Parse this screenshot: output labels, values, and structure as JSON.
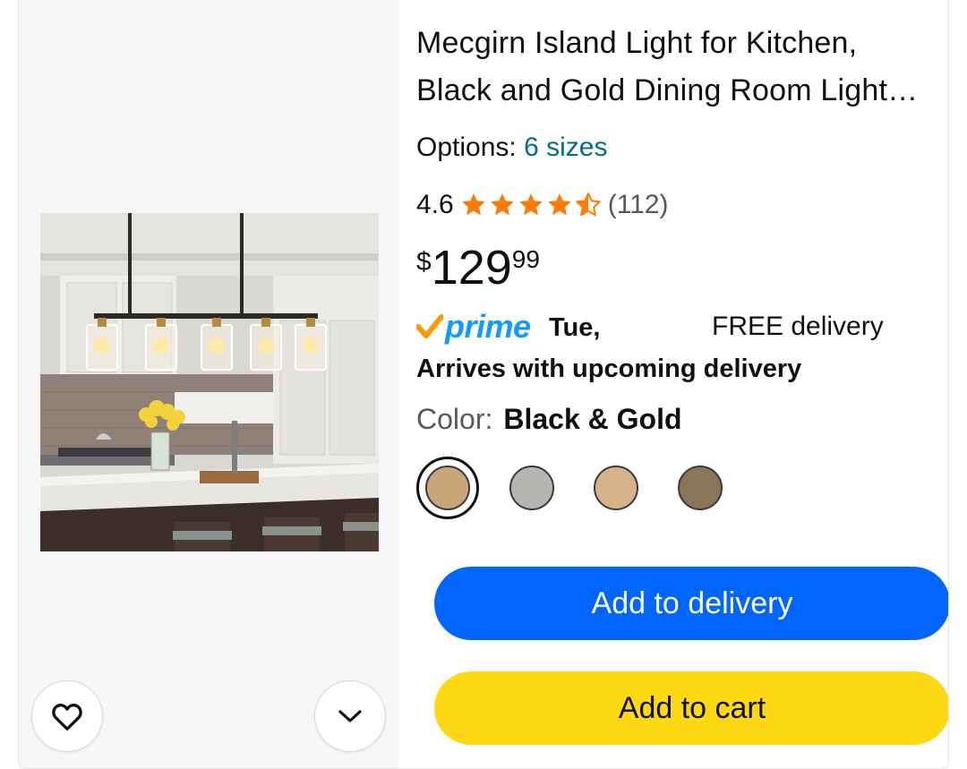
{
  "product": {
    "title": "Mecgirn Island Light for Kitchen, Black and Gold Dining Room Light Fixture",
    "options_label": "Options:",
    "options_value": "6 sizes",
    "rating_value": "4.6",
    "rating_count": "(112)",
    "rating_stars": 4.6,
    "price_symbol": "$",
    "price_whole": "129",
    "price_fraction": "99",
    "prime_label": "prime",
    "delivery_day": "Tue,",
    "delivery_text": "FREE delivery",
    "arrives_text": "Arrives with upcoming delivery",
    "color_label": "Color:",
    "color_value": "Black & Gold",
    "swatches": [
      {
        "color": "#c9a57a",
        "selected": true
      },
      {
        "color": "#b6b6b1",
        "selected": false
      },
      {
        "color": "#d4b38c",
        "selected": false
      },
      {
        "color": "#8a7559",
        "selected": false
      }
    ]
  },
  "buttons": {
    "add_to_delivery": "Add to delivery",
    "add_to_cart": "Add to cart"
  },
  "icons": {
    "wishlist": "heart-icon",
    "more": "chevron-down-icon"
  },
  "colors": {
    "link": "#007185",
    "star": "#ff7a00",
    "prime": "#1399ff",
    "delivery_button": "#0066ff",
    "cart_button": "#ffd814"
  }
}
